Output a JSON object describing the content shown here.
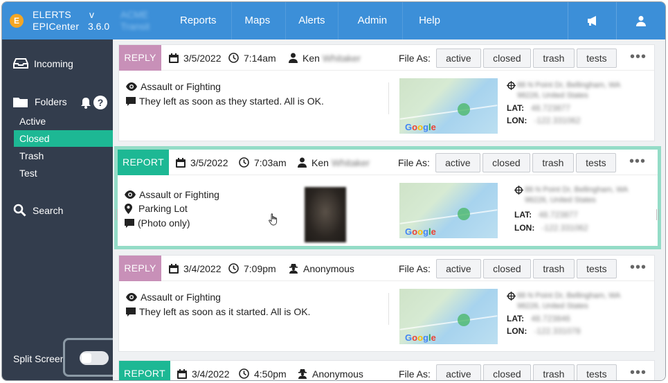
{
  "app": {
    "brand_line1": "ELERTS",
    "brand_line2": "EPICenter",
    "version_line1": "v",
    "version_line2": "3.6.0",
    "client_line1": "ACME",
    "client_line2": "Transit",
    "accent": "#3c8fd8"
  },
  "nav": [
    "Reports",
    "Maps",
    "Alerts",
    "Admin",
    "Help"
  ],
  "icons": {
    "announce": "megaphone-icon",
    "user": "user-icon"
  },
  "sidebar": {
    "incoming": "Incoming",
    "folders": "Folders",
    "items": [
      {
        "label": "Active"
      },
      {
        "label": "Closed"
      },
      {
        "label": "Trash"
      },
      {
        "label": "Test"
      }
    ],
    "search": "Search",
    "split_screen": "Split Screen",
    "active_color": "#1db894"
  },
  "file_as": {
    "label": "File As:",
    "options": [
      "active",
      "closed",
      "trash",
      "tests"
    ]
  },
  "more": "•••",
  "cards": [
    {
      "type": "REPLY",
      "date": "3/5/2022",
      "time": "7:14am",
      "user": "Ken",
      "user_blur": "Whitaker",
      "line1": "Assault or Fighting",
      "line2": "They left as soon as they started. All is OK.",
      "addr1": "88 N Point Dr, Bellingham, WA",
      "addr2": "98226, United States",
      "lat_label": "LAT:",
      "lat": "48.723877",
      "lon_label": "LON:",
      "lon": "-122.331062"
    },
    {
      "type": "REPORT",
      "date": "3/5/2022",
      "time": "7:03am",
      "user": "Ken",
      "user_blur": "Whitaker",
      "line1": "Assault or Fighting",
      "line2": "Parking Lot",
      "line3": "(Photo only)",
      "addr1": "88 N Point Dr, Bellingham, WA",
      "addr2": "98226, United States",
      "lat_label": "LAT:",
      "lat": "48.723877",
      "lon_label": "LON:",
      "lon": "-122.331062"
    },
    {
      "type": "REPLY",
      "date": "3/4/2022",
      "time": "7:09pm",
      "user": "Anonymous",
      "line1": "Assault or Fighting",
      "line2": "They left as soon as it started. All is OK.",
      "addr1": "88 N Point Dr, Bellingham, WA",
      "addr2": "98226, United States",
      "lat_label": "LAT:",
      "lat": "48.723846",
      "lon_label": "LON:",
      "lon": "-122.331078"
    },
    {
      "type": "REPORT",
      "date": "3/4/2022",
      "time": "4:50pm",
      "user": "Anonymous"
    }
  ],
  "map": {
    "g1": "G",
    "g2": "o",
    "g3": "o",
    "g4": "g",
    "g5": "l",
    "g6": "e"
  }
}
